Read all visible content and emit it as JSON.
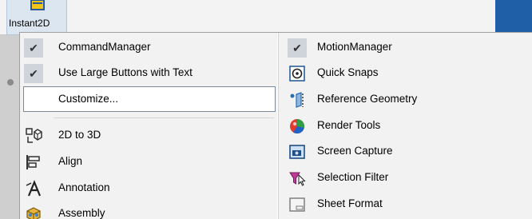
{
  "toolbar": {
    "button_label": "Instant2D"
  },
  "menu": {
    "left_column": [
      {
        "label": "CommandManager",
        "icon": "check-icon",
        "checked": true
      },
      {
        "label": "Use Large Buttons with Text",
        "icon": "check-icon",
        "checked": true
      },
      {
        "label": "Customize...",
        "icon": "",
        "checked": false
      },
      {
        "label": "2D to 3D",
        "icon": "2d-to-3d-icon"
      },
      {
        "label": "Align",
        "icon": "align-icon"
      },
      {
        "label": "Annotation",
        "icon": "annotation-icon"
      },
      {
        "label": "Assembly",
        "icon": "assembly-icon"
      }
    ],
    "right_column": [
      {
        "label": "MotionManager",
        "icon": "check-icon",
        "checked": true
      },
      {
        "label": "Quick Snaps",
        "icon": "quick-snaps-icon"
      },
      {
        "label": "Reference Geometry",
        "icon": "reference-geometry-icon"
      },
      {
        "label": "Render Tools",
        "icon": "render-tools-icon"
      },
      {
        "label": "Screen Capture",
        "icon": "screen-capture-icon"
      },
      {
        "label": "Selection Filter",
        "icon": "selection-filter-icon"
      },
      {
        "label": "Sheet Format",
        "icon": "sheet-format-icon"
      }
    ]
  },
  "check_glyph": "✔",
  "colors": {
    "menu_bg": "#f2f2f2",
    "highlight_bg": "#ffffff",
    "check_bg": "#cfd4da",
    "accent_blue": "#1f5fa8"
  }
}
